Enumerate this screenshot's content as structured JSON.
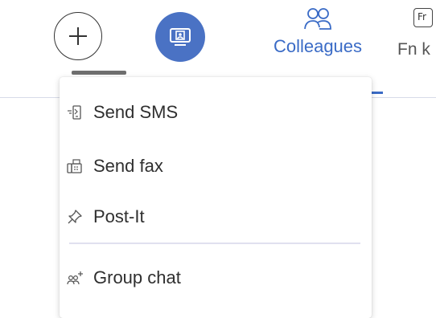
{
  "toolbar": {
    "add_button": {
      "icon": "plus-icon"
    },
    "screen_share_button": {
      "icon": "screen-share-icon",
      "color": "#4a72c4"
    },
    "tabs": [
      {
        "label": "Colleagues",
        "icon": "colleagues-icon",
        "active": true,
        "color": "#3a6bc6"
      },
      {
        "label": "Fn k",
        "icon_text": "Fr",
        "icon": "function-keys-icon"
      }
    ]
  },
  "menu": {
    "items": [
      {
        "label": "Send SMS",
        "icon": "sms-icon"
      },
      {
        "label": "Send fax",
        "icon": "fax-icon"
      },
      {
        "label": "Post-It",
        "icon": "pin-icon"
      },
      {
        "label": "Group chat",
        "icon": "group-add-icon"
      }
    ]
  }
}
